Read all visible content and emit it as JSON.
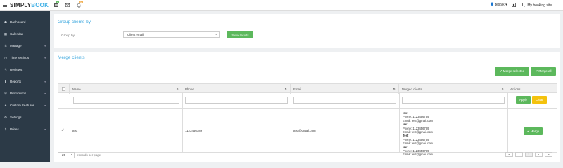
{
  "topbar": {
    "logo_part1": "SIMPLY",
    "logo_part2": "BOOK",
    "badges": [
      "2",
      "12"
    ],
    "user": "testvk",
    "user_caret": "▾",
    "site_link": "My booking site"
  },
  "sidebar": {
    "items": [
      {
        "label": "Dashboard",
        "icon": "☗",
        "caret": ""
      },
      {
        "label": "Calendar",
        "icon": "▦",
        "caret": ""
      },
      {
        "label": "Manage",
        "icon": "⚒",
        "caret": "▾"
      },
      {
        "label": "Time settings",
        "icon": "◷",
        "caret": "▾"
      },
      {
        "label": "Reviews",
        "icon": "✎",
        "caret": ""
      },
      {
        "label": "Reports",
        "icon": "▮",
        "caret": "▾"
      },
      {
        "label": "Promotions",
        "icon": "✆",
        "caret": "▾"
      },
      {
        "label": "Custom Features",
        "icon": "✦",
        "caret": "▾"
      },
      {
        "label": "Settings",
        "icon": "⚙",
        "caret": ""
      },
      {
        "label": "Prices",
        "icon": "$",
        "caret": "▾"
      }
    ]
  },
  "group_panel": {
    "title": "Group clients by",
    "group_label": "Group by",
    "select_value": "Client email",
    "show_results": "Show results"
  },
  "merge_panel": {
    "title": "Merge clients",
    "merge_selected": "✔ Merge selected",
    "merge_all": "✔ Merge all",
    "columns": [
      "Name",
      "Phone",
      "Email",
      "Merged clients",
      "Actions"
    ],
    "apply": "Apply",
    "clear": "Clear",
    "row": {
      "checked": "✔",
      "name": "test",
      "phone": "1123456789",
      "email": "test@gmail.com",
      "merged": [
        {
          "name": "test",
          "phone": "Phone: 1123456789",
          "email": "Email: test@gmail.com"
        },
        {
          "name": "test",
          "phone": "Phone: 1123456789",
          "email": "Email: test@gmail.com"
        },
        {
          "name": "Test",
          "phone": "Phone: 1123456789",
          "email": "Email: test@gmail.com"
        },
        {
          "name": "test",
          "phone": "Phone: 1123456789",
          "email": "Email: test@gmail.com"
        }
      ],
      "merge_button": "✔ Merge"
    },
    "per_page_value": "25",
    "per_page_label": "records per page",
    "pages": [
      "«",
      "‹",
      "1",
      "›",
      "»"
    ]
  }
}
